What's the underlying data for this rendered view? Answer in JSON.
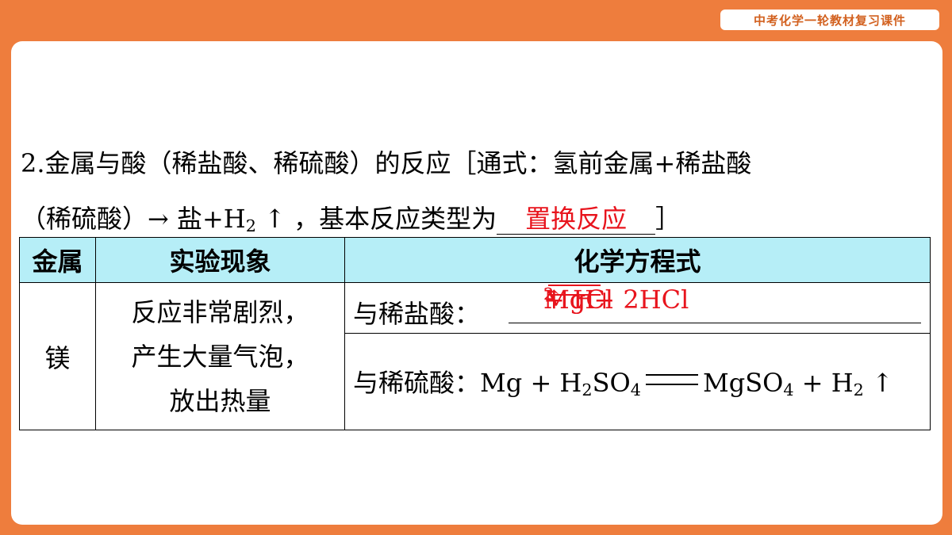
{
  "header": {
    "badge": "中考化学一轮教材复习课件"
  },
  "intro": {
    "line1": "2.金属与酸（稀盐酸、稀硫酸）的反应［通式：氢前金属+稀盐酸",
    "line2_before": "（稀硫酸）→ 盐+H",
    "line2_sub": "2",
    "line2_after": "↑ ，基本反应类型为",
    "answer": "置换反应",
    "close": "］"
  },
  "table": {
    "headers": [
      "金属",
      "实验现象",
      "化学方程式"
    ],
    "metal": "镁",
    "phenomenon": [
      "反应非常剧烈，",
      "产生大量气泡，",
      "放出热量"
    ],
    "row1": {
      "label": "与稀盐酸：",
      "lhs": "Mg + 2HCl",
      "rhs_a": "MgCl",
      "rhs_sub": "2",
      "rhs_b": " + H",
      "rhs_sub2": "2",
      "rhs_c": " ↑"
    },
    "row2": {
      "label": "与稀硫酸：",
      "lhs_a": "Mg + H",
      "lhs_sub": "2",
      "lhs_b": "SO",
      "lhs_sub2": "4",
      "rhs_a": "MgSO",
      "rhs_sub": "4",
      "rhs_b": " + H",
      "rhs_sub2": "2",
      "rhs_c": " ↑"
    }
  },
  "colors": {
    "frame": "#ee7d3d",
    "header_fill": "#b6eef7",
    "answer": "#e8141d"
  }
}
